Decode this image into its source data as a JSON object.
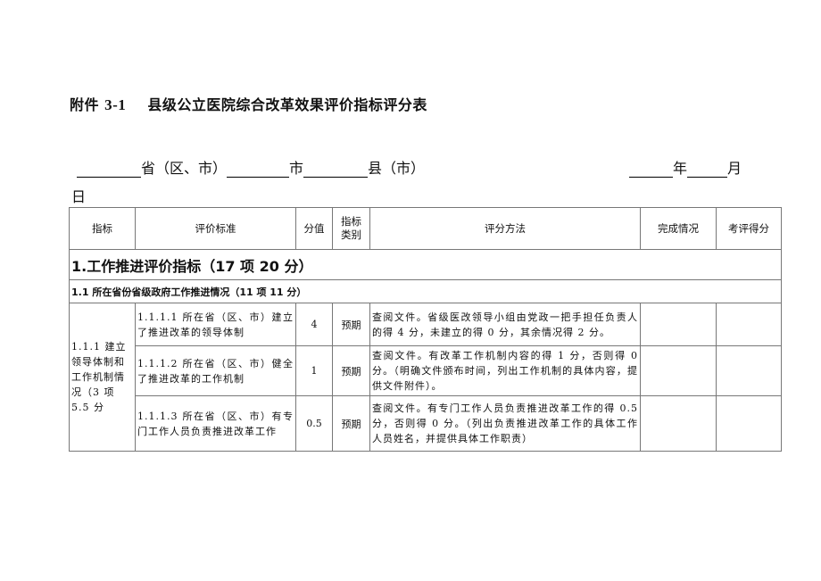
{
  "document": {
    "title_prefix": "附件",
    "title_number": "3-1",
    "title_text": "县级公立医院综合改革效果评价指标评分表",
    "location_line": {
      "province_label": "省（区、市）",
      "city_label": "市",
      "county_label": "县（市）"
    },
    "date_line": {
      "year_label": "年",
      "month_label": "月",
      "day_label": "日"
    }
  },
  "table": {
    "headers": [
      "指标",
      "评价标准",
      "分值",
      "指标类别",
      "评分方法",
      "完成情况",
      "考评得分"
    ],
    "section": "1.工作推进评价指标（17 项 20 分）",
    "subsection": "1.1 所在省份省级政府工作推进情况（11 项 11 分）",
    "group_label": "1.1.1 建立领导体制和工作机制情况（3 项 5.5 分",
    "rows": [
      {
        "criterion": "1.1.1.1 所在省（区、市）建立了推进改革的领导体制",
        "score": "4",
        "category": "预期",
        "method": "查阅文件。省级医改领导小组由党政一把手担任负责人的得 4 分，未建立的得 0 分，其余情况得 2 分。",
        "completion": "",
        "evaluation_score": ""
      },
      {
        "criterion": "1.1.1.2 所在省（区、市）健全了推进改革的工作机制",
        "score": "1",
        "category": "预期",
        "method": "查阅文件。有改革工作机制内容的得 1 分，否则得 0 分。（明确文件颁布时间，列出工作机制的具体内容，提供文件附件）。",
        "completion": "",
        "evaluation_score": ""
      },
      {
        "criterion": "1.1.1.3 所在省（区、市）有专门工作人员负责推进改革工作",
        "score": "0.5",
        "category": "预期",
        "method": "查阅文件。有专门工作人员负责推进改革工作的得 0.5 分，否则得 0 分。（列出负责推进改革工作的具体工作人员姓名，并提供具体工作职责）",
        "completion": "",
        "evaluation_score": ""
      }
    ]
  }
}
